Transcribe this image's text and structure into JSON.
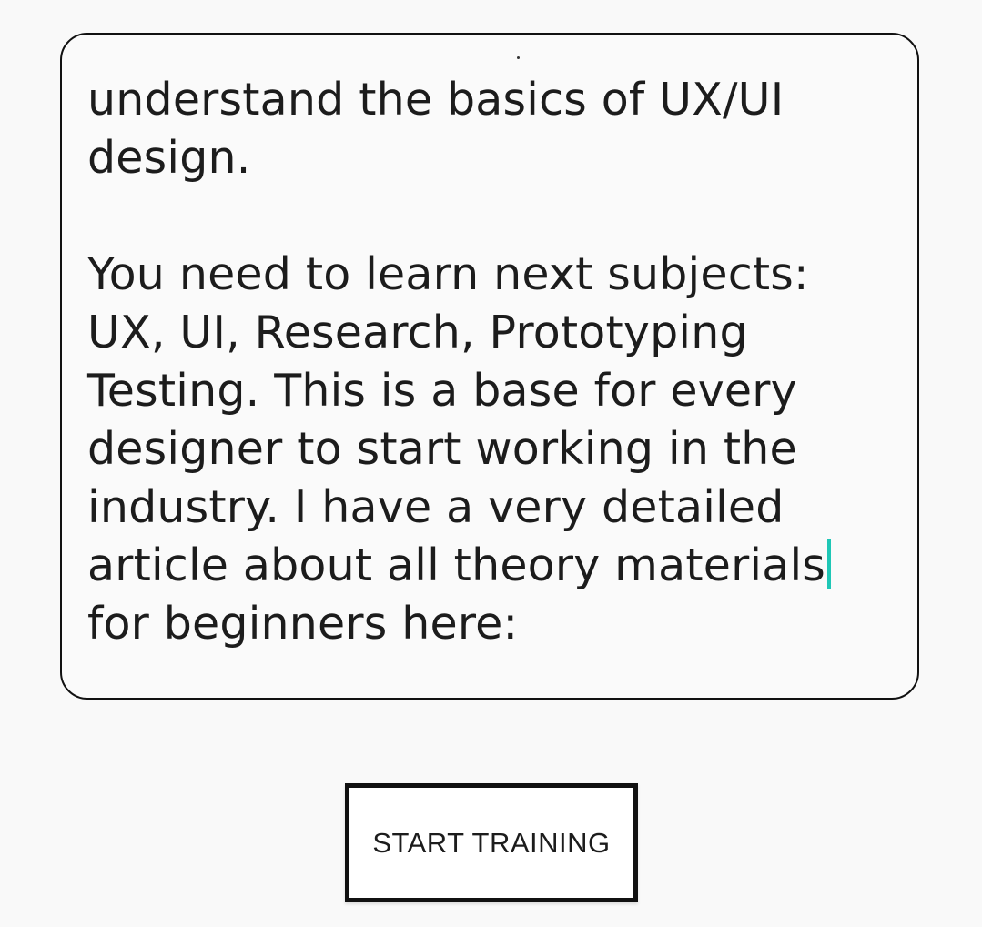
{
  "editor": {
    "lines": [
      "understand the basics of UX/UI",
      "design.",
      "",
      "You need to learn next subjects:",
      "UX, UI, Research, Prototyping",
      "Testing. This is a base for every",
      "designer to start working in the",
      "industry. I have a very detailed",
      "article about all theory materials",
      "for beginners here:"
    ],
    "caret_color": "#1fc7b6"
  },
  "actions": {
    "start_label": "START TRAINING"
  }
}
